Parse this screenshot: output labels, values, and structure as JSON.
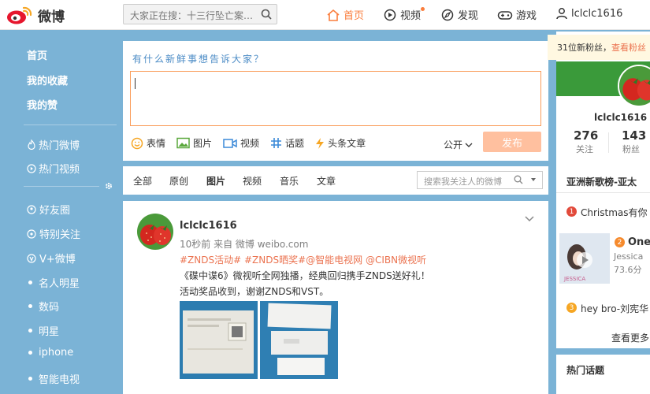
{
  "app": {
    "logo_text": "微博"
  },
  "search": {
    "placeholder": "大家正在搜：十三行坠亡案…"
  },
  "nav": {
    "home": "首页",
    "video": "视频",
    "discover": "发现",
    "game": "游戏",
    "user": "lclclc1616"
  },
  "sidebar": {
    "primary": [
      "首页",
      "我的收藏",
      "我的赞"
    ],
    "secondary": [
      "热门微博",
      "热门视频"
    ],
    "groups": [
      "好友圈",
      "特别关注",
      "V+微博"
    ],
    "categories": [
      "名人明星",
      "数码",
      "明星",
      "iphone",
      "智能电视"
    ]
  },
  "publisher": {
    "prompt": "有什么新鲜事想告诉大家？",
    "tools": [
      "表情",
      "图片",
      "视频",
      "话题",
      "头条文章"
    ],
    "scope": "公开",
    "submit": "发布"
  },
  "feed_tabs": {
    "items": [
      "全部",
      "原创",
      "图片",
      "视频",
      "音乐",
      "文章"
    ],
    "active": "图片",
    "search_placeholder": "搜索我关注人的微博"
  },
  "post": {
    "user": "lclclc1616",
    "meta": "10秒前 来自 微博 weibo.com",
    "tags": "#ZNDS活动# #ZNDS晒奖#@智能电视网 @CIBN微视听",
    "line1": "《碟中谍6》微视听全网独播，经典回归携手ZNDS送好礼！",
    "line2": "活动奖品收到，谢谢ZNDS和VST。"
  },
  "profile": {
    "notice": "31位新粉丝，",
    "notice_link": "查看粉丝",
    "name": "lclclc1616",
    "follow_count": "276",
    "follow_label": "关注",
    "fans_count": "143",
    "fans_label": "粉丝"
  },
  "hot_list": {
    "title": "亚洲新歌榜-亚太",
    "items": [
      {
        "rank": "1",
        "text": "Christmas有你"
      },
      {
        "rank": "2",
        "text": "One",
        "sub": "Jessica",
        "duration": "73.6分"
      },
      {
        "rank": "3",
        "text": "hey bro-刘宪华"
      }
    ],
    "more": "查看更多"
  },
  "topics": {
    "title": "热门话题"
  },
  "colors": {
    "accent": "#fa7d3c",
    "link": "#eb7350",
    "page_bg": "#7bb3d6",
    "rank1": "#e24a3b",
    "rank2": "#f68a2c",
    "rank3": "#f6a623"
  }
}
